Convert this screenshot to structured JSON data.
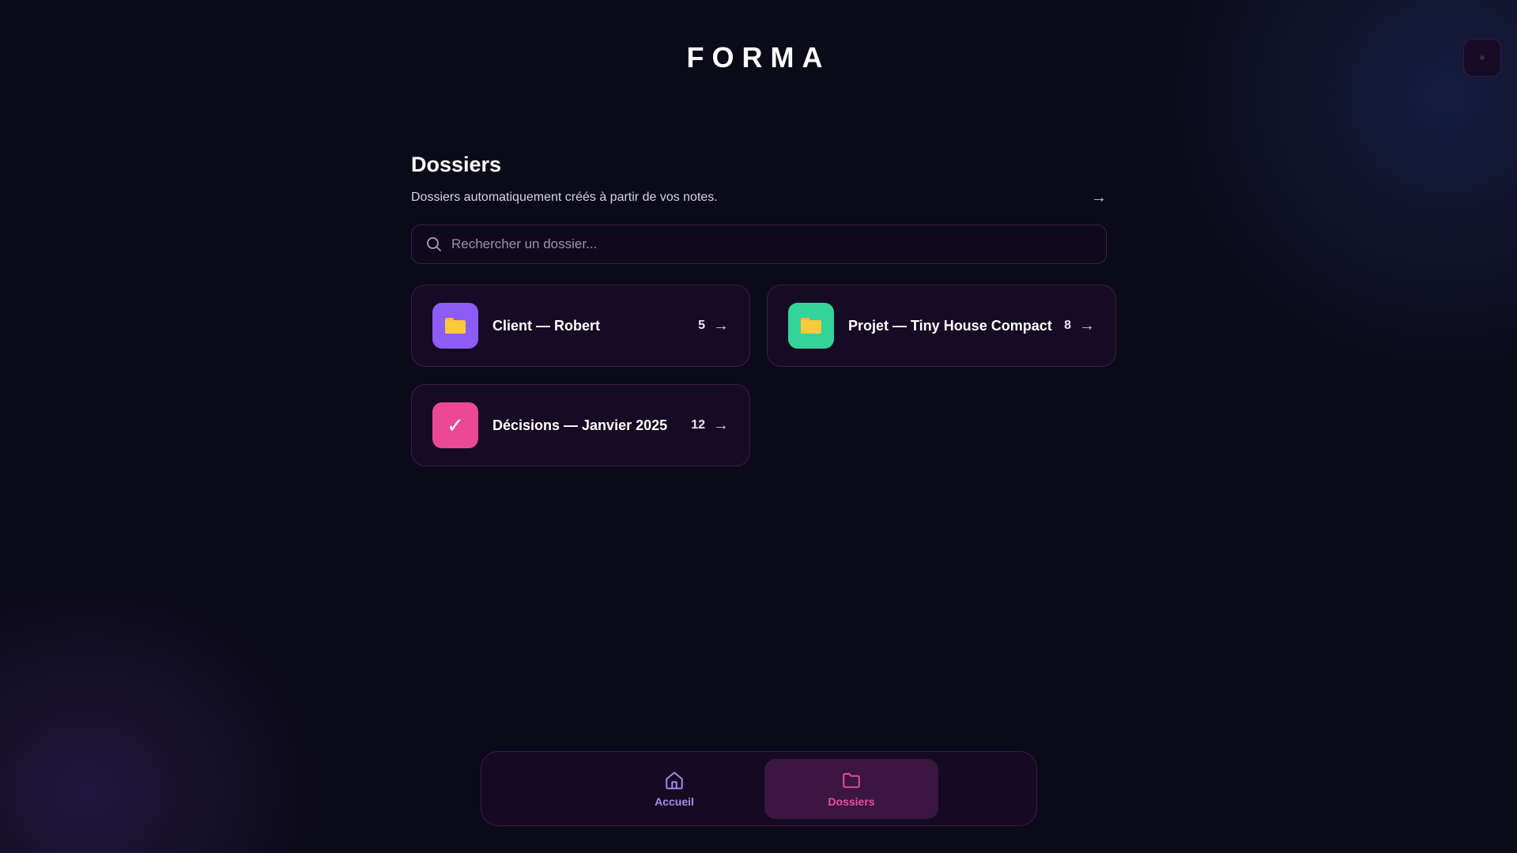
{
  "app": {
    "logo": "FORMA"
  },
  "header": {
    "title": "Dossiers",
    "subtitle": "Dossiers automatiquement créés à partir de vos notes.",
    "arrow": "→"
  },
  "search": {
    "placeholder": "Rechercher un dossier...",
    "value": ""
  },
  "folders": [
    {
      "name": "Client — Robert",
      "count": "5",
      "arrow": "→",
      "icon": "folder-icon",
      "icon_bg": "#8b5cf6"
    },
    {
      "name": "Projet — Tiny House Compact",
      "count": "8",
      "arrow": "→",
      "icon": "folder-icon",
      "icon_bg": "#34d399"
    },
    {
      "name": "Décisions — Janvier 2025",
      "count": "12",
      "arrow": "→",
      "icon": "check-icon",
      "icon_bg": "#ec4899",
      "icon_glyph": "✓"
    }
  ],
  "nav": {
    "home_label": "Accueil",
    "folders_label": "Dossiers",
    "active": "Dossiers",
    "home_color": "#a98af0",
    "active_color": "#ec4d9c"
  }
}
